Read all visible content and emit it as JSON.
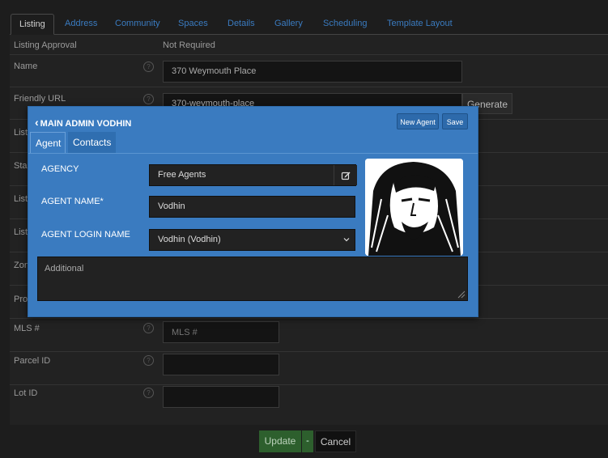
{
  "tabs": [
    "Listing",
    "Address",
    "Community",
    "Spaces",
    "Details",
    "Gallery",
    "Scheduling",
    "Template Layout"
  ],
  "form": {
    "listing_approval_label": "Listing Approval",
    "listing_approval_value": "Not Required",
    "name_label": "Name",
    "name_value": "370 Weymouth Place",
    "friendly_url_label": "Friendly URL",
    "friendly_url_value": "370-weymouth-place",
    "generate_label": "Generate",
    "hidden_labels": [
      "List",
      "Sta",
      "List",
      "List",
      "Zon",
      "Pro"
    ],
    "mls_label": "MLS #",
    "mls_placeholder": "MLS #",
    "parcel_label": "Parcel ID",
    "lot_label": "Lot ID",
    "help_icon": "?"
  },
  "modal": {
    "title": "MAIN ADMIN VODHIN",
    "back_icon": "‹",
    "new_agent_label": "New Agent",
    "save_label": "Save",
    "tabs": [
      "Agent",
      "Contacts"
    ],
    "agency_label": "AGENCY",
    "agency_value": "Free Agents",
    "agent_name_label": "AGENT NAME*",
    "agent_name_value": "Vodhin",
    "login_label": "AGENT LOGIN NAME",
    "login_value": "Vodhin (Vodhin)",
    "additional_placeholder": "Additional"
  },
  "footer": {
    "update_label": "Update",
    "caret": "-",
    "cancel_label": "Cancel"
  },
  "colors": {
    "modal_blue": "#3a7bc0",
    "update_green": "#2d5f2d",
    "tab_link": "#3a7bc0"
  },
  "icons": {
    "help": "help-circle-icon",
    "edit": "edit-icon",
    "back": "chevron-left-icon",
    "dropdown": "chevron-down-icon",
    "resize": "resize-grip-icon"
  }
}
